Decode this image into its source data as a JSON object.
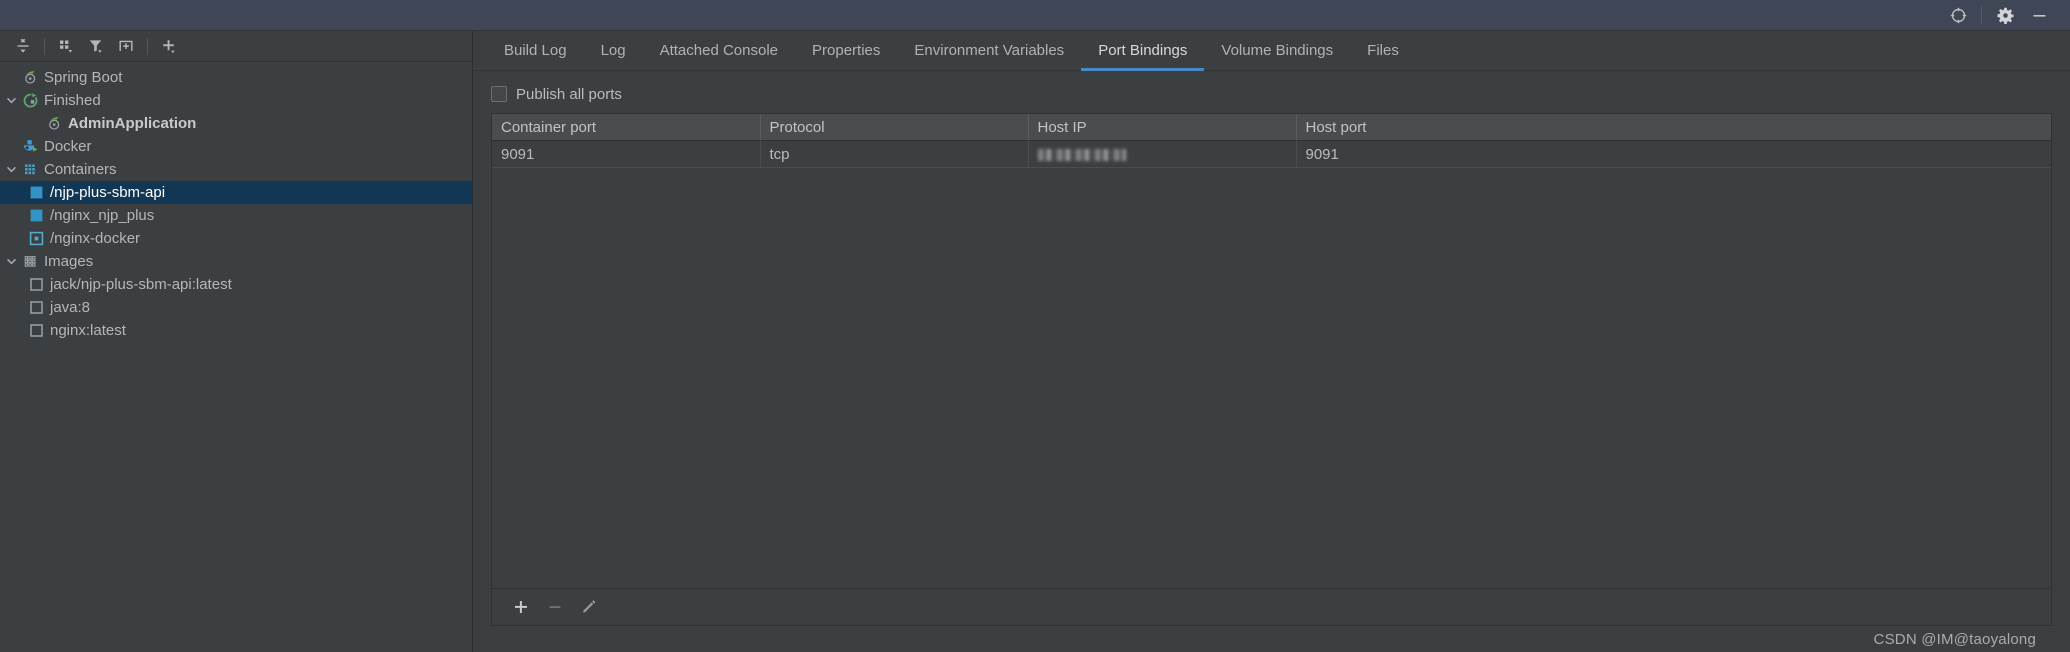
{
  "window": {
    "actions": [
      {
        "name": "locate-icon",
        "label": "Locate"
      },
      {
        "name": "settings-icon",
        "label": "Settings"
      },
      {
        "name": "minimize-icon",
        "label": "Minimize"
      }
    ]
  },
  "left_panel": {
    "toolbar": [
      {
        "name": "expand-collapse-icon",
        "label": "Expand / Collapse"
      },
      {
        "name": "group-by-icon",
        "label": "Group By"
      },
      {
        "name": "filter-icon",
        "label": "Filter"
      },
      {
        "name": "new-watch-icon",
        "label": "New Watch"
      },
      {
        "name": "add-icon",
        "label": "Add"
      }
    ],
    "tree": [
      {
        "label": "Spring Boot",
        "icon": "spring-boot-icon",
        "indent": 0,
        "twisty": "",
        "selected": false,
        "bold": false
      },
      {
        "label": "Finished",
        "icon": "finished-icon",
        "indent": 1,
        "twisty": "expanded",
        "selected": false,
        "bold": false
      },
      {
        "label": "AdminApplication",
        "icon": "spring-boot-icon",
        "indent": 2,
        "twisty": "",
        "selected": false,
        "bold": true
      },
      {
        "label": "Docker",
        "icon": "docker-icon",
        "indent": 0,
        "twisty": "",
        "selected": false,
        "bold": false
      },
      {
        "label": "Containers",
        "icon": "containers-icon",
        "indent": 1,
        "twisty": "expanded",
        "selected": false,
        "bold": false
      },
      {
        "label": "/njp-plus-sbm-api",
        "icon": "container-running-icon",
        "indent": 2,
        "twisty": "",
        "selected": true,
        "bold": false
      },
      {
        "label": "/nginx_njp_plus",
        "icon": "container-running-icon",
        "indent": 2,
        "twisty": "",
        "selected": false,
        "bold": false
      },
      {
        "label": "/nginx-docker",
        "icon": "container-stopped-icon",
        "indent": 2,
        "twisty": "",
        "selected": false,
        "bold": false
      },
      {
        "label": "Images",
        "icon": "images-icon",
        "indent": 1,
        "twisty": "expanded",
        "selected": false,
        "bold": false
      },
      {
        "label": "jack/njp-plus-sbm-api:latest",
        "icon": "image-icon",
        "indent": 2,
        "twisty": "",
        "selected": false,
        "bold": false
      },
      {
        "label": "java:8",
        "icon": "image-icon",
        "indent": 2,
        "twisty": "",
        "selected": false,
        "bold": false
      },
      {
        "label": "nginx:latest",
        "icon": "image-icon",
        "indent": 2,
        "twisty": "",
        "selected": false,
        "bold": false
      }
    ]
  },
  "right_panel": {
    "tabs": [
      {
        "label": "Build Log",
        "active": false
      },
      {
        "label": "Log",
        "active": false
      },
      {
        "label": "Attached Console",
        "active": false
      },
      {
        "label": "Properties",
        "active": false
      },
      {
        "label": "Environment Variables",
        "active": false
      },
      {
        "label": "Port Bindings",
        "active": true
      },
      {
        "label": "Volume Bindings",
        "active": false
      },
      {
        "label": "Files",
        "active": false
      }
    ],
    "publish_all_ports": {
      "label": "Publish all ports",
      "checked": false
    },
    "table": {
      "columns": [
        "Container port",
        "Protocol",
        "Host IP",
        "Host port"
      ],
      "rows": [
        {
          "container_port": "9091",
          "protocol": "tcp",
          "host_ip": "",
          "host_ip_redacted": true,
          "host_port": "9091"
        }
      ]
    },
    "bottom_toolbar": [
      {
        "name": "add-binding-icon",
        "label": "Add"
      },
      {
        "name": "remove-binding-icon",
        "label": "Remove"
      },
      {
        "name": "edit-binding-icon",
        "label": "Edit"
      }
    ]
  },
  "watermark": "CSDN @IM@taoyalong",
  "colors": {
    "background": "#3c3f41",
    "titlebar": "#3f4655",
    "selection": "#123754",
    "accent": "#4a88c7",
    "header": "#4a4d50",
    "text": "#bbbbbb"
  }
}
